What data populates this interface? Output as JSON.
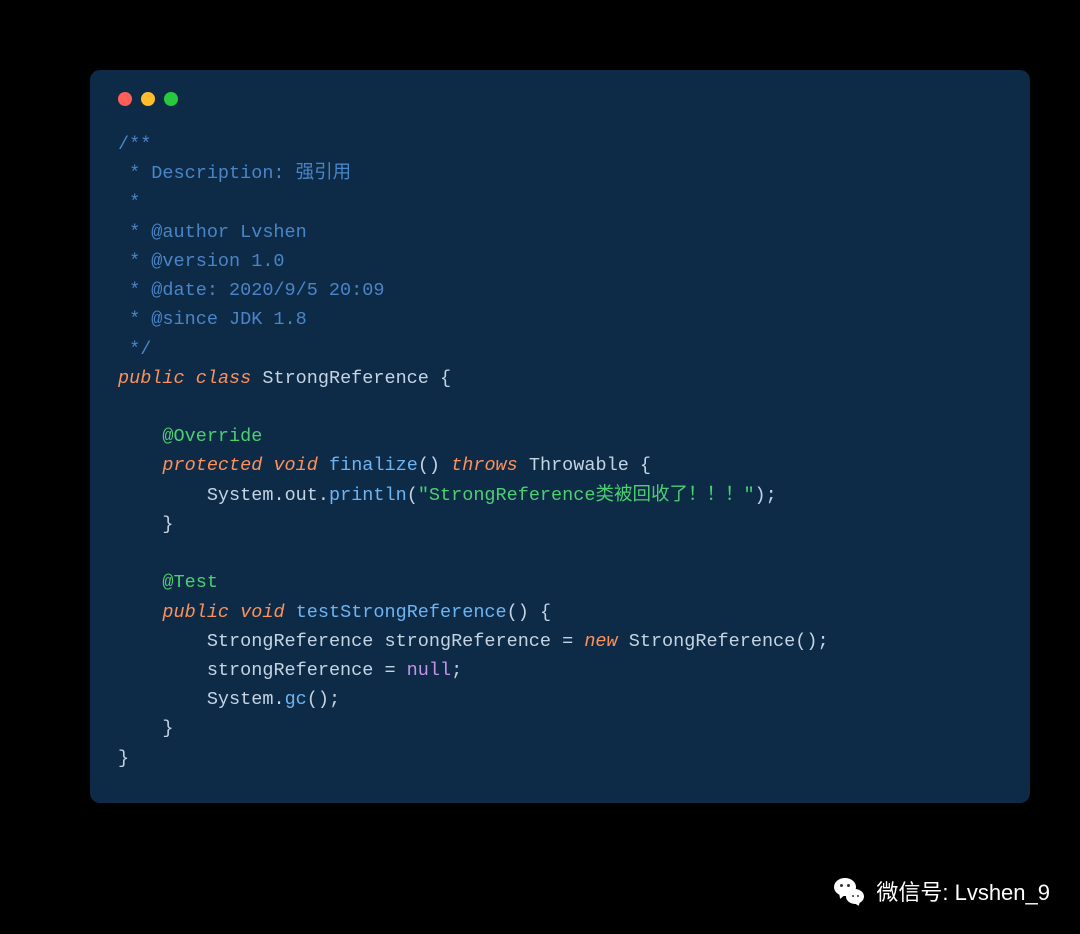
{
  "code": {
    "c1": "/**",
    "c2": " * Description: 强引用",
    "c3": " *",
    "c4": " * @author Lvshen",
    "c5": " * @version 1.0",
    "c6": " * @date: 2020/9/5 20:09",
    "c7": " * @since JDK 1.8",
    "c8": " */",
    "kw_public": "public",
    "kw_class": "class",
    "cls_name": "StrongReference",
    "brace_open": " {",
    "anno_override": "@Override",
    "kw_protected": "protected",
    "kw_void": "void",
    "m_finalize": "finalize",
    "paren": "()",
    "kw_throws": "throws",
    "cls_throwable": "Throwable",
    "sys": "System",
    "out": "out",
    "println": "println",
    "str_val": "\"StrongReference类被回收了！！！\"",
    "semi": ";",
    "brace_close": "}",
    "anno_test": "@Test",
    "m_test": "testStrongReference",
    "var_type": "StrongReference",
    "var_name": "strongReference",
    "eq": " = ",
    "kw_new": "new",
    "ctor": "StrongReference",
    "lit_null": "null",
    "gc": "gc",
    "dot": ".",
    "lparen": "(",
    "rparen": ")"
  },
  "watermark": {
    "label": "微信号: Lvshen_9"
  }
}
